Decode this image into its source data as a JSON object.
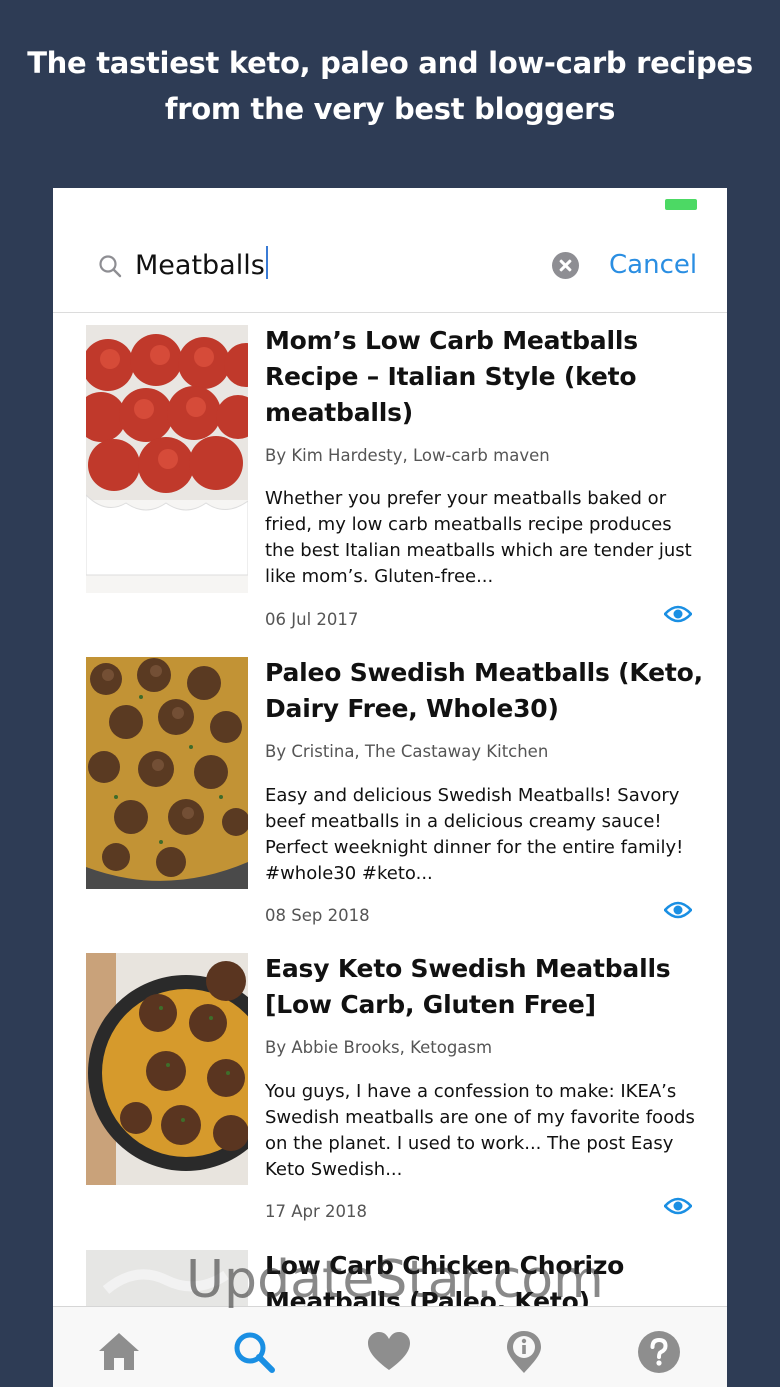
{
  "promo": {
    "line1": "The tastiest keto, paleo and low-carb recipes",
    "line2": "from the very best bloggers"
  },
  "search": {
    "query": "Meatballs",
    "cancel_label": "Cancel"
  },
  "results": [
    {
      "title": "Mom’s Low Carb Meatballs Recipe – Italian Style (keto meatballs)",
      "author": "By Kim Hardesty, Low-carb maven",
      "description": "Whether you prefer your meatballs baked or fried, my low carb meatballs recipe produces the best Italian meatballs which are tender just like mom’s. Gluten-free...",
      "date": "06 Jul 2017"
    },
    {
      "title": "Paleo Swedish Meatballs (Keto, Dairy Free, Whole30)",
      "author": "By Cristina, The Castaway Kitchen",
      "description": "Easy and delicious Swedish Meatballs! Savory beef meatballs in a delicious creamy sauce! Perfect weeknight dinner for the entire family! #whole30 #keto...",
      "date": "08 Sep 2018"
    },
    {
      "title": "Easy Keto Swedish Meatballs [Low Carb, Gluten Free]",
      "author": "By Abbie Brooks, Ketogasm",
      "description": "You guys, I have a confession to make: IKEA’s Swedish meatballs are one of my favorite foods on the planet. I used to work... The post Easy Keto Swedish...",
      "date": "17 Apr 2018"
    },
    {
      "title": "Low Carb Chicken Chorizo Meatballs (Paleo, Keto)"
    }
  ],
  "watermark": "UpdateStar.com",
  "tabbar": {
    "tabs": [
      "home-icon",
      "search-icon",
      "heart-icon",
      "info-icon",
      "help-icon"
    ],
    "active_color": "#1a8fe3",
    "inactive_color": "#8e8e8e"
  },
  "colors": {
    "background": "#2e3c55",
    "accent": "#2a8ee2",
    "battery": "#4cd964"
  }
}
